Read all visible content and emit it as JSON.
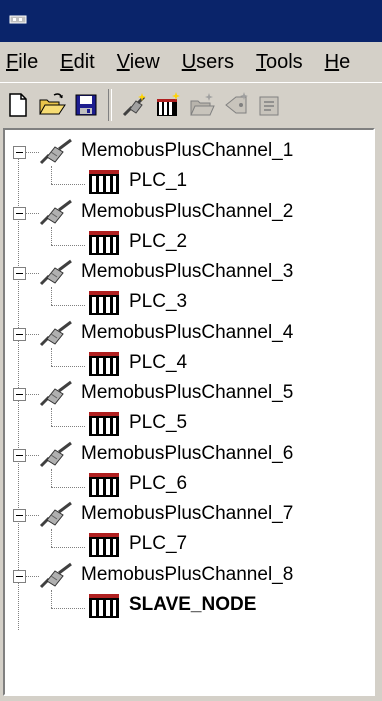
{
  "menu": {
    "items": [
      {
        "mnemonic": "F",
        "rest": "ile"
      },
      {
        "mnemonic": "E",
        "rest": "dit"
      },
      {
        "mnemonic": "V",
        "rest": "iew"
      },
      {
        "mnemonic": "U",
        "rest": "sers"
      },
      {
        "mnemonic": "T",
        "rest": "ools"
      },
      {
        "mnemonic": "H",
        "rest": "e"
      }
    ]
  },
  "toolbar": {
    "icons": [
      "new-document-icon",
      "open-folder-icon",
      "save-disk-icon",
      "add-channel-icon",
      "add-device-icon",
      "add-group-icon",
      "add-tag-icon",
      "properties-icon"
    ]
  },
  "tree": {
    "channels": [
      {
        "label": "MemobusPlusChannel_1",
        "device": "PLC_1"
      },
      {
        "label": "MemobusPlusChannel_2",
        "device": "PLC_2"
      },
      {
        "label": "MemobusPlusChannel_3",
        "device": "PLC_3"
      },
      {
        "label": "MemobusPlusChannel_4",
        "device": "PLC_4"
      },
      {
        "label": "MemobusPlusChannel_5",
        "device": "PLC_5"
      },
      {
        "label": "MemobusPlusChannel_6",
        "device": "PLC_6"
      },
      {
        "label": "MemobusPlusChannel_7",
        "device": "PLC_7"
      },
      {
        "label": "MemobusPlusChannel_8",
        "device": "SLAVE_NODE"
      }
    ]
  },
  "colors": {
    "titlebar": "#0a246a",
    "face": "#d4d0c8",
    "tree_bg": "#ffffff"
  }
}
